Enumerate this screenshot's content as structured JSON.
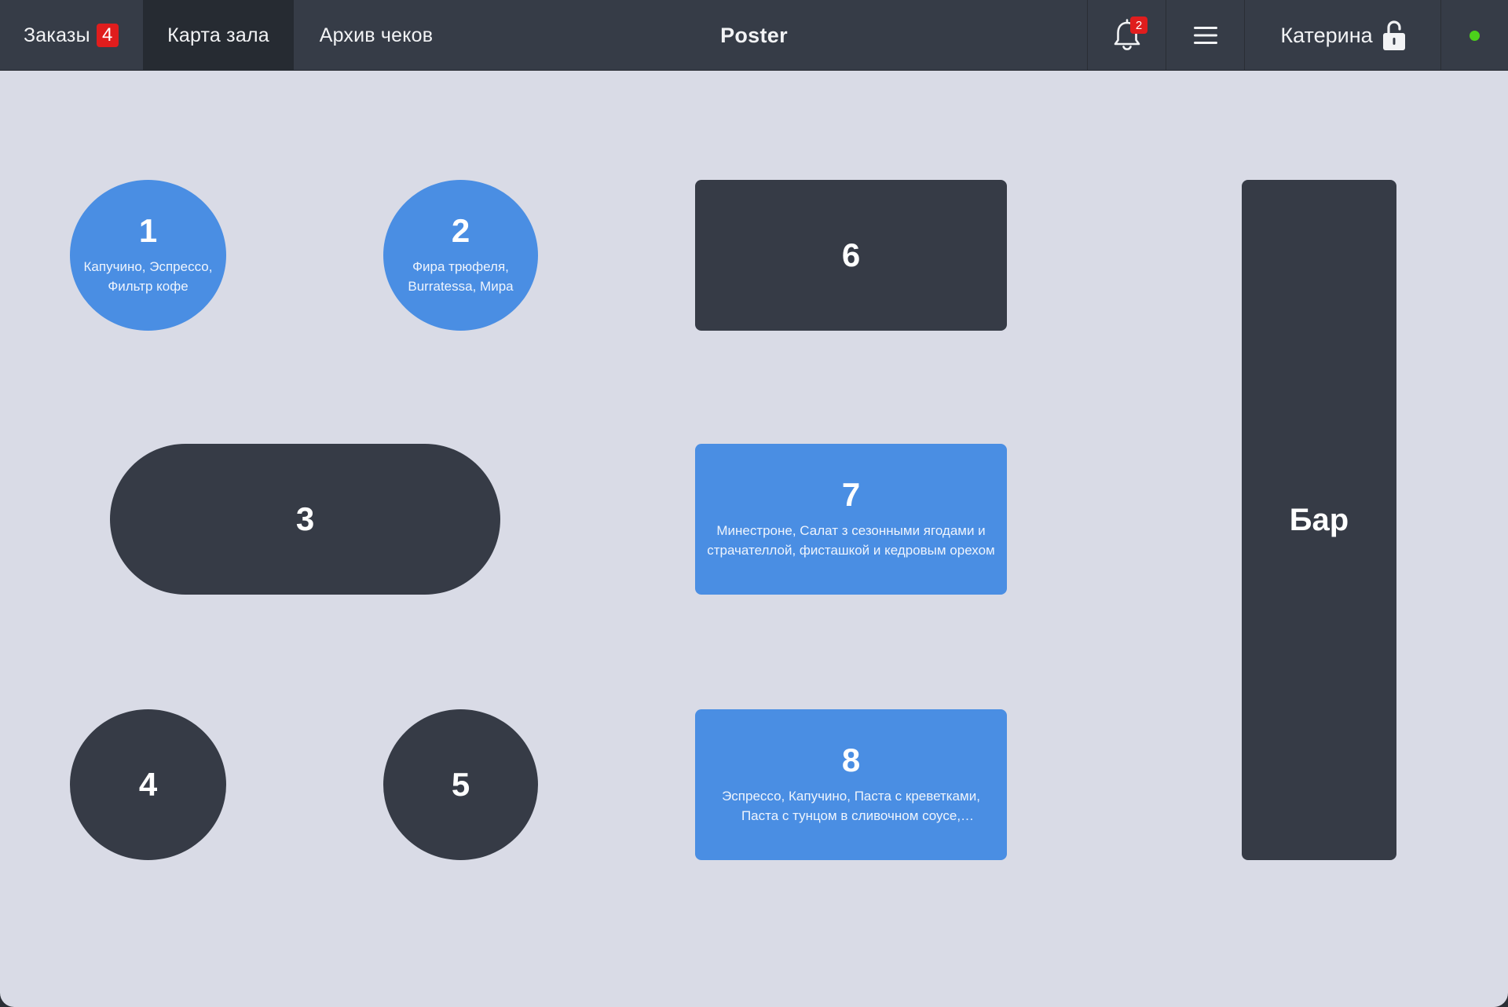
{
  "header": {
    "tabs": {
      "orders": {
        "label": "Заказы",
        "badge": "4"
      },
      "hall_map": {
        "label": "Карта зала"
      },
      "archive": {
        "label": "Архив чеков"
      }
    },
    "brand": "Poster",
    "notifications_badge": "2",
    "user_name": "Катерина",
    "icons": {
      "bell": "bell-icon",
      "menu": "hamburger-menu-icon",
      "lock": "unlocked-padlock-icon",
      "status": "online-status-dot"
    },
    "status_color": "#4cd21b"
  },
  "tables": {
    "t1": {
      "number": "1",
      "items": "Капучино, Эспрессо, Фильтр кофе",
      "state": "busy"
    },
    "t2": {
      "number": "2",
      "items": "Фира трюфеля, Burratessa, Мира",
      "state": "busy"
    },
    "t3": {
      "number": "3",
      "items": "",
      "state": "free"
    },
    "t4": {
      "number": "4",
      "items": "",
      "state": "free"
    },
    "t5": {
      "number": "5",
      "items": "",
      "state": "free"
    },
    "t6": {
      "number": "6",
      "items": "",
      "state": "free"
    },
    "t7": {
      "number": "7",
      "items": "Минестроне, Салат з сезонными ягодами и страчателлой, фисташкой и кедровым орехом",
      "state": "busy"
    },
    "t8": {
      "number": "8",
      "items": "Эспрессо, Капучино, Паста с креветками, Паста с тунцом в сливочном соусе, Минестроне",
      "state": "busy"
    },
    "bar": {
      "number": "Бар",
      "items": "",
      "state": "free"
    }
  },
  "colors": {
    "busy_table": "#4a8ee3",
    "free_table": "#363b46",
    "floor": "#d9dbe6",
    "topbar": "#363c47",
    "badge": "#e01d1d"
  }
}
